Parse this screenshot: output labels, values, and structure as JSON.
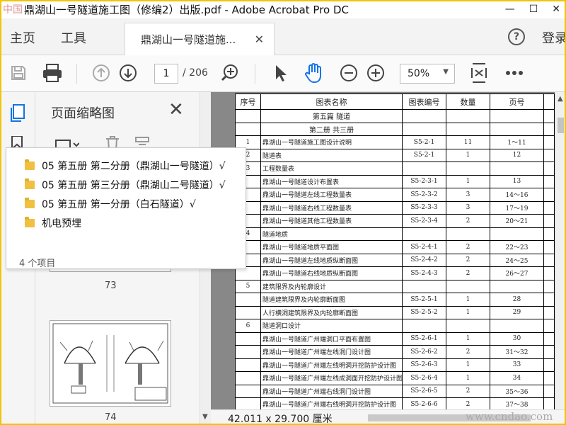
{
  "window": {
    "title": "鼎湖山一号隧道施工图（修编2）出版.pdf - Adobe Acrobat Pro DC",
    "watermark_logo": "中国"
  },
  "tabs": {
    "home": "主页",
    "tools": "工具",
    "doc_tab": "鼎湖山一号隧道施...",
    "login": "登录"
  },
  "toolbar": {
    "page_current": "1",
    "page_total": "/ 206",
    "zoom": "50%"
  },
  "panel": {
    "title": "页面缩略图",
    "thumb_a_num": "73",
    "thumb_b_num": "74"
  },
  "popup": {
    "folders": [
      "05 第五册 第二分册（鼎湖山一号隧道）√",
      "05 第五册 第三分册（鼎湖山二号隧道）√",
      "05 第五册 第一分册（白石隧道）√",
      "机电预埋"
    ],
    "count": "4 个项目"
  },
  "status": {
    "dimensions": "42.011 x 29.700 厘米",
    "watermark": "www.cndao.com"
  },
  "toc": {
    "headers": [
      "序号",
      "图表名称",
      "图表编号",
      "数量",
      "页号"
    ],
    "volume": "第五篇  隧道",
    "book": "第二册  共三册",
    "rows": [
      {
        "no": "1",
        "name": "鼎湖山一号隧道施工图设计说明",
        "code": "S5-2-1",
        "qty": "11",
        "page": "1～11",
        "bold": true
      },
      {
        "no": "2",
        "name": "隧道表",
        "code": "S5-2-1",
        "qty": "1",
        "page": "12",
        "bold": true
      },
      {
        "no": "3",
        "name": "工程数量表",
        "code": "",
        "qty": "",
        "page": "",
        "bold": true
      },
      {
        "no": "",
        "name": "鼎湖山一号隧道设计布置表",
        "code": "S5-2-3-1",
        "qty": "1",
        "page": "13"
      },
      {
        "no": "",
        "name": "鼎湖山一号隧道左线工程数量表",
        "code": "S5-2-3-2",
        "qty": "3",
        "page": "14～16"
      },
      {
        "no": "",
        "name": "鼎湖山一号隧道右线工程数量表",
        "code": "S5-2-3-3",
        "qty": "3",
        "page": "17～19"
      },
      {
        "no": "",
        "name": "鼎湖山一号隧道其他工程数量表",
        "code": "S5-2-3-4",
        "qty": "2",
        "page": "20～21"
      },
      {
        "no": "4",
        "name": "隧道地质",
        "code": "",
        "qty": "",
        "page": "",
        "bold": true
      },
      {
        "no": "",
        "name": "鼎湖山一号隧道地质平面图",
        "code": "S5-2-4-1",
        "qty": "2",
        "page": "22～23"
      },
      {
        "no": "",
        "name": "鼎湖山一号隧道左线地质纵断面图",
        "code": "S5-2-4-2",
        "qty": "2",
        "page": "24～25"
      },
      {
        "no": "",
        "name": "鼎湖山一号隧道右线地质纵断面图",
        "code": "S5-2-4-3",
        "qty": "2",
        "page": "26～27"
      },
      {
        "no": "5",
        "name": "建筑限界及内轮廓设计",
        "code": "",
        "qty": "",
        "page": "",
        "bold": true
      },
      {
        "no": "",
        "name": "隧道建筑限界及内轮廓断面图",
        "code": "S5-2-5-1",
        "qty": "1",
        "page": "28"
      },
      {
        "no": "",
        "name": "人行横洞建筑限界及内轮廓断面图",
        "code": "S5-2-5-2",
        "qty": "1",
        "page": "29"
      },
      {
        "no": "6",
        "name": "隧道洞口设计",
        "code": "",
        "qty": "",
        "page": "",
        "bold": true
      },
      {
        "no": "",
        "name": "鼎湖山一号隧道广州端洞口平面布置图",
        "code": "S5-2-6-1",
        "qty": "1",
        "page": "30"
      },
      {
        "no": "",
        "name": "鼎湖山一号隧道广州端左线洞门设计图",
        "code": "S5-2-6-2",
        "qty": "2",
        "page": "31～32"
      },
      {
        "no": "",
        "name": "鼎湖山一号隧道广州端左线明洞开挖防护设计图",
        "code": "S5-2-6-3",
        "qty": "1",
        "page": "33"
      },
      {
        "no": "",
        "name": "鼎湖山一号隧道广州端左线成洞面开挖防护设计图",
        "code": "S5-2-6-4",
        "qty": "1",
        "page": "34"
      },
      {
        "no": "",
        "name": "鼎湖山一号隧道广州端右线洞门设计图",
        "code": "S5-2-6-5",
        "qty": "2",
        "page": "35～36"
      },
      {
        "no": "",
        "name": "鼎湖山一号隧道广州端右线明洞开挖防护设计图",
        "code": "S5-2-6-6",
        "qty": "2",
        "page": "37～38"
      }
    ]
  }
}
